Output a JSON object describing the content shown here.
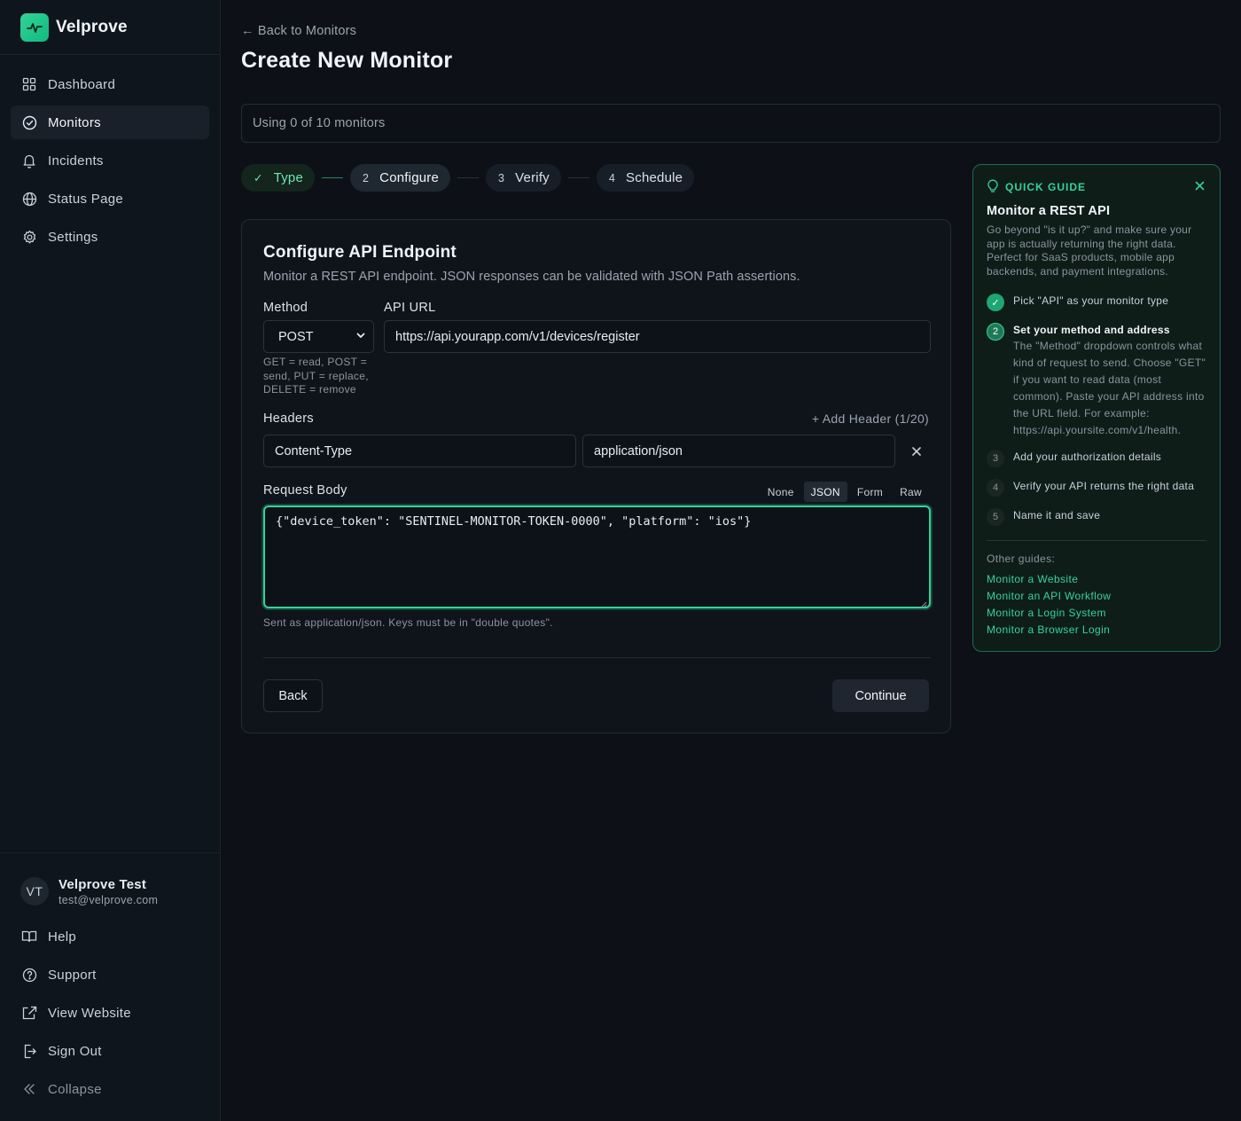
{
  "brand": {
    "name": "Velprove"
  },
  "nav": [
    {
      "label": "Dashboard",
      "icon": "dashboard-icon"
    },
    {
      "label": "Monitors",
      "icon": "check-circle-icon",
      "active": true
    },
    {
      "label": "Incidents",
      "icon": "bell-icon"
    },
    {
      "label": "Status Page",
      "icon": "globe-icon"
    },
    {
      "label": "Settings",
      "icon": "gear-icon"
    }
  ],
  "user": {
    "initials": "VT",
    "name": "Velprove Test",
    "email": "test@velprove.com"
  },
  "bottom_nav": [
    {
      "label": "Help",
      "icon": "book-icon"
    },
    {
      "label": "Support",
      "icon": "question-circle-icon"
    },
    {
      "label": "View Website",
      "icon": "external-link-icon"
    },
    {
      "label": "Sign Out",
      "icon": "sign-out-icon"
    },
    {
      "label": "Collapse",
      "icon": "chevrons-left-icon"
    }
  ],
  "page": {
    "back_label": "← Back to Monitors",
    "title": "Create New Monitor",
    "usage": "Using 0 of 10 monitors"
  },
  "steps": [
    {
      "num": "✓",
      "label": "Type",
      "state": "done"
    },
    {
      "num": "2",
      "label": "Configure",
      "state": "current"
    },
    {
      "num": "3",
      "label": "Verify",
      "state": "upcoming"
    },
    {
      "num": "4",
      "label": "Schedule",
      "state": "upcoming"
    }
  ],
  "form": {
    "title": "Configure API Endpoint",
    "subtitle": "Monitor a REST API endpoint. JSON responses can be validated with JSON Path assertions.",
    "method_label": "Method",
    "method_value": "POST",
    "method_hint": "GET = read, POST = send, PUT = replace, DELETE = remove",
    "url_label": "API URL",
    "url_value": "https://api.yourapp.com/v1/devices/register",
    "headers_label": "Headers",
    "add_header": "+ Add Header (1/20)",
    "header_key": "Content-Type",
    "header_value": "application/json",
    "body_label": "Request Body",
    "body_tabs": [
      "None",
      "JSON",
      "Form",
      "Raw"
    ],
    "body_tab_active": "JSON",
    "body_value": "{\"device_token\": \"SENTINEL-MONITOR-TOKEN-0000\", \"platform\": \"ios\"}",
    "body_hint": "Sent as application/json. Keys must be in \"double quotes\".",
    "back_button": "Back",
    "continue_button": "Continue"
  },
  "guide": {
    "heading": "QUICK GUIDE",
    "title": "Monitor a REST API",
    "description": "Go beyond \"is it up?\" and make sure your app is actually returning the right data. Perfect for SaaS products, mobile app backends, and payment integrations.",
    "steps": [
      {
        "num": "✓",
        "text": "Pick \"API\" as your monitor type",
        "state": "done"
      },
      {
        "num": "2",
        "text": "Set your method and address",
        "state": "current",
        "detail": "The \"Method\" dropdown controls what kind of request to send. Choose \"GET\" if you want to read data (most common). Paste your API address into the URL field. For example: https://api.yoursite.com/v1/health."
      },
      {
        "num": "3",
        "text": "Add your authorization details",
        "state": "upcoming"
      },
      {
        "num": "4",
        "text": "Verify your API returns the right data",
        "state": "upcoming"
      },
      {
        "num": "5",
        "text": "Name it and save",
        "state": "upcoming"
      }
    ],
    "other_label": "Other guides:",
    "links": [
      "Monitor a Website",
      "Monitor an API Workflow",
      "Monitor a Login System",
      "Monitor a Browser Login"
    ]
  },
  "colors": {
    "accent": "#34d399",
    "background": "#0d1117",
    "sidebar": "#0f151c"
  }
}
